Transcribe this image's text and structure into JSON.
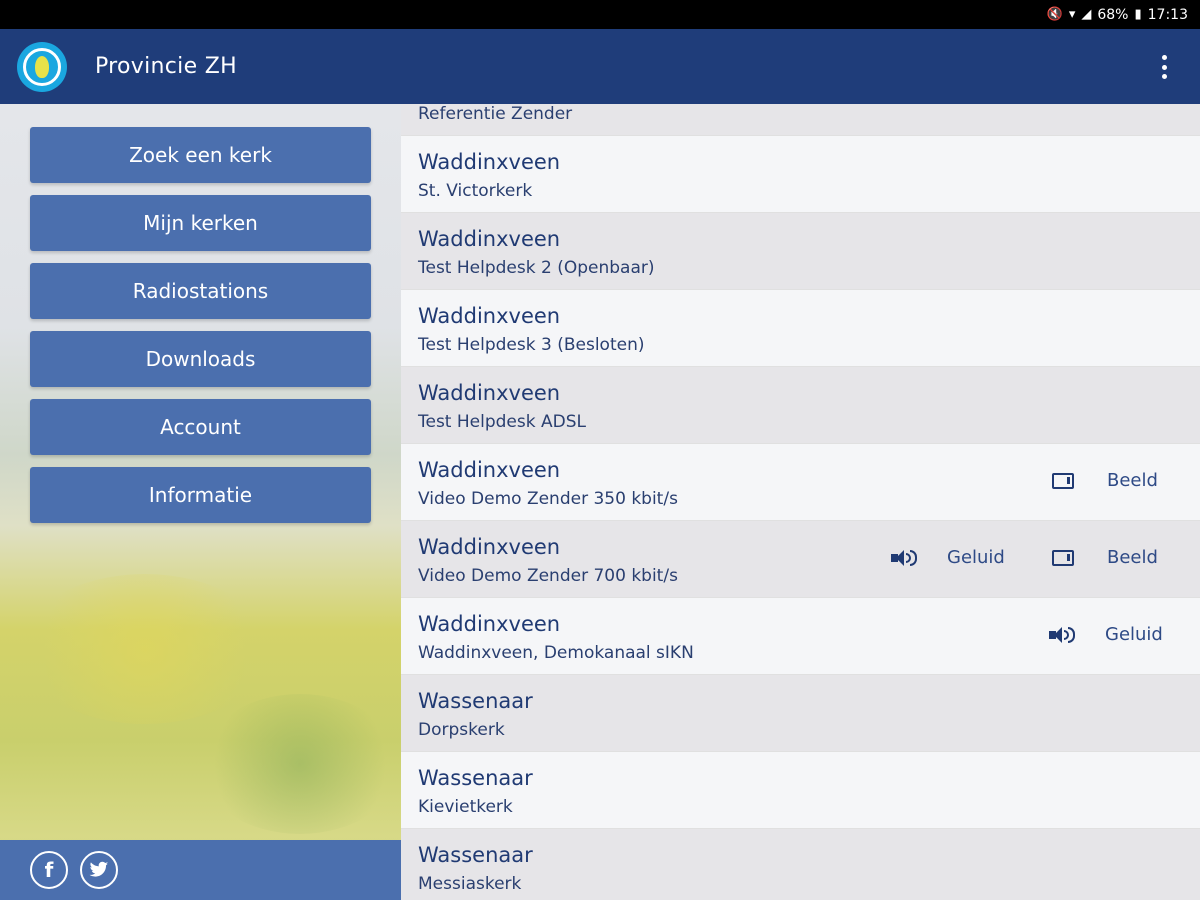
{
  "status": {
    "battery": "68%",
    "time": "17:13"
  },
  "app": {
    "title": "Provincie ZH"
  },
  "menu": [
    {
      "label": "Zoek een kerk"
    },
    {
      "label": "Mijn kerken"
    },
    {
      "label": "Radiostations"
    },
    {
      "label": "Downloads"
    },
    {
      "label": "Account"
    },
    {
      "label": "Informatie"
    }
  ],
  "social": {
    "facebook": "f",
    "twitter": "t"
  },
  "list": {
    "partial_name": "Referentie Zender",
    "rows": [
      {
        "city": "Waddinxveen",
        "name": "St. Victorkerk"
      },
      {
        "city": "Waddinxveen",
        "name": "Test Helpdesk 2 (Openbaar)"
      },
      {
        "city": "Waddinxveen",
        "name": "Test Helpdesk 3 (Besloten)"
      },
      {
        "city": "Waddinxveen",
        "name": "Test Helpdesk ADSL"
      },
      {
        "city": "Waddinxveen",
        "name": "Video Demo Zender 350 kbit/s",
        "video": "Beeld"
      },
      {
        "city": "Waddinxveen",
        "name": "Video Demo Zender 700 kbit/s",
        "audio": "Geluid",
        "video": "Beeld"
      },
      {
        "city": "Waddinxveen",
        "name": "Waddinxveen, Demokanaal sIKN",
        "audio": "Geluid"
      },
      {
        "city": "Wassenaar",
        "name": "Dorpskerk"
      },
      {
        "city": "Wassenaar",
        "name": "Kievietkerk"
      },
      {
        "city": "Wassenaar",
        "name": "Messiaskerk"
      }
    ]
  },
  "icons": {
    "audio": "speaker-icon",
    "video": "tv-icon",
    "overflow": "more-vert-icon"
  },
  "colors": {
    "appbar": "#1f3d7a",
    "menu_button": "#4b6fae",
    "text_primary": "#203a73"
  }
}
